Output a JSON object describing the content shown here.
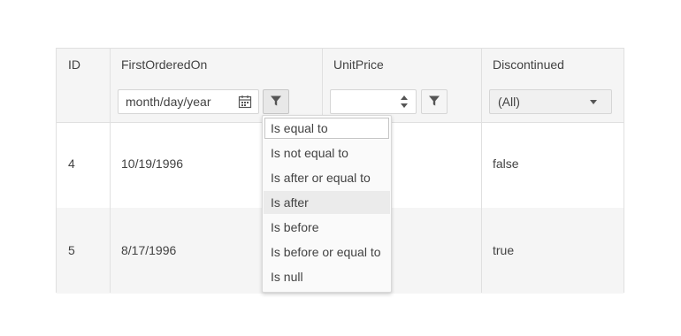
{
  "columns": {
    "id": "ID",
    "first_ordered_on": "FirstOrderedOn",
    "unit_price": "UnitPrice",
    "discontinued": "Discontinued"
  },
  "filters": {
    "date_placeholder": "month/day/year",
    "discontinued_value": "(All)"
  },
  "rows": [
    {
      "id": "4",
      "first_ordered_on": "10/19/1996",
      "unit_price": "",
      "discontinued": "false"
    },
    {
      "id": "5",
      "first_ordered_on": "8/17/1996",
      "unit_price": "",
      "discontinued": "true"
    }
  ],
  "operator_menu": [
    "Is equal to",
    "Is not equal to",
    "Is after or equal to",
    "Is after",
    "Is before",
    "Is before or equal to",
    "Is null"
  ],
  "colors": {
    "header_bg": "#f5f5f5",
    "border": "#e0e0e0",
    "text": "#424242"
  }
}
